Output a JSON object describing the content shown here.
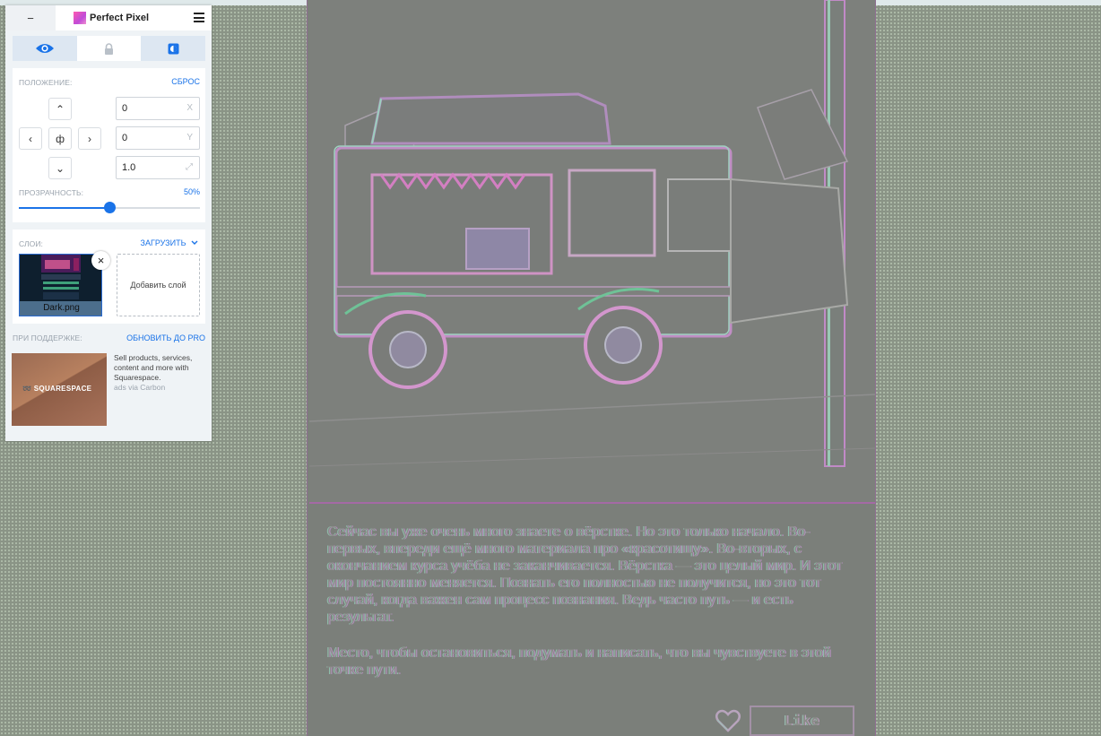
{
  "panel": {
    "app_name": "Perfect Pixel",
    "minimize_label": "−",
    "tabs": [
      {
        "icon": "eye-icon"
      },
      {
        "icon": "lock-icon"
      },
      {
        "icon": "invert-icon"
      }
    ],
    "position": {
      "label": "ПОЛОЖЕНИЕ:",
      "reset": "СБРОС",
      "up": "⌃",
      "left": "‹",
      "center": "ф",
      "right": "›",
      "down": "⌄",
      "x_value": "0",
      "x_suffix": "X",
      "y_value": "0",
      "y_suffix": "Y",
      "scale_value": "1.0",
      "scale_suffix": "⤢"
    },
    "opacity": {
      "label": "ПРОЗРАЧНОСТЬ:",
      "value_text": "50%",
      "value": 0.5
    },
    "layers": {
      "label": "СЛОИ:",
      "upload": "ЗАГРУЗИТЬ",
      "items": [
        {
          "name": "Dark.png"
        }
      ],
      "remove": "×",
      "add_layer": "Добавить слой"
    },
    "support": {
      "label": "ПРИ ПОДДЕРЖКЕ:",
      "upgrade": "ОБНОВИТЬ ДО PRO"
    },
    "ad": {
      "logo": "SQUARESPACE",
      "text": "Sell products, services, content and more with Squarespace.",
      "via": "ads via Carbon"
    }
  },
  "article": {
    "paragraph1": "Сейчас вы уже очень много знаете о вёрстке. Но это только начало. Во-первых, впереди ещё много материала про «красотищу». Во-вторых, с окончанием курса учёба не заканчивается. Вёрстка — это целый мир. И этот мир постоянно меняется. Познать его полностью не получится, но это тот случай, когда важен сам процесс познания. Ведь часто путь — и есть результат.",
    "paragraph2": "Место, чтобы остановиться, подумать и написать, что вы чувствуете в этой точке пути.",
    "like_label": "Like"
  },
  "colors": {
    "accent": "#1a73e8",
    "overlay_bg": "#7b7f7a"
  }
}
